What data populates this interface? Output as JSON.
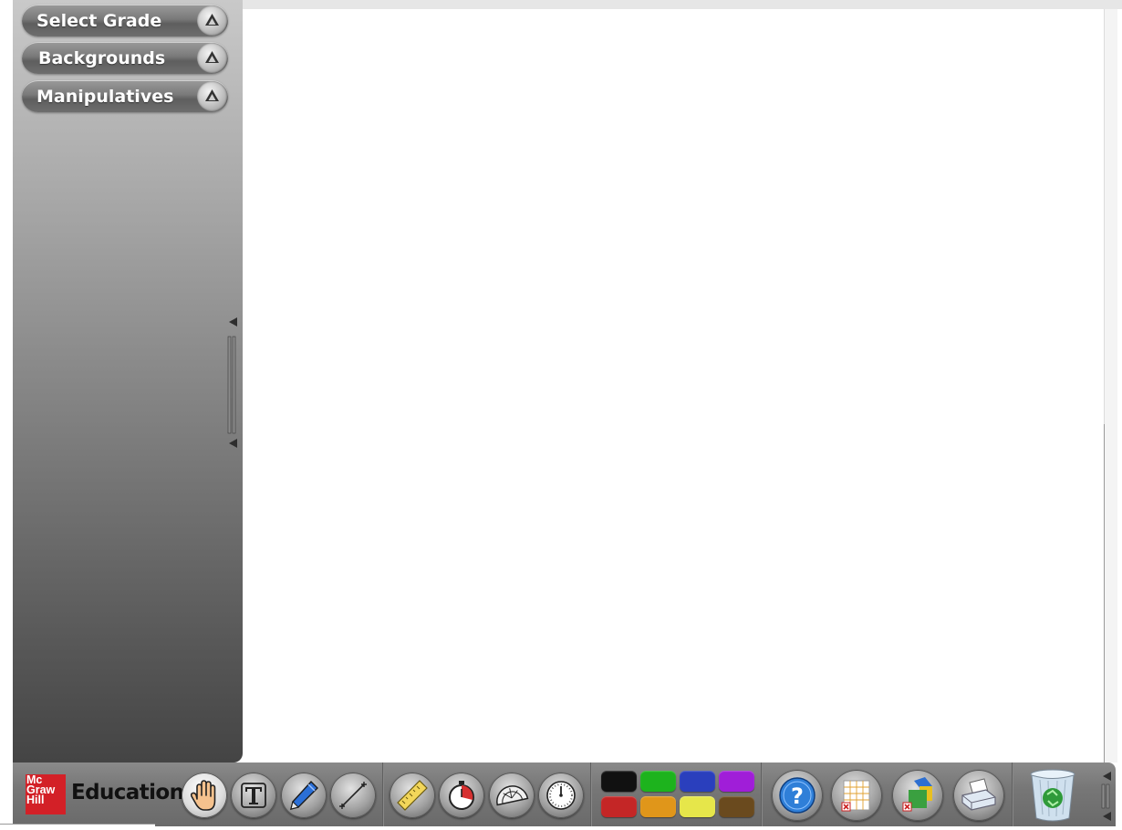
{
  "sidebar": {
    "menus": [
      {
        "label": "Select Grade",
        "icon": "chevron-up-icon"
      },
      {
        "label": "Backgrounds",
        "icon": "chevron-up-icon"
      },
      {
        "label": "Manipulatives",
        "icon": "chevron-up-icon"
      }
    ],
    "collapse_icon": "collapse-handle-icon"
  },
  "toolbar": {
    "logo": {
      "line1": "Mc",
      "line2": "Graw",
      "line3": "Hill",
      "brand": "Education"
    },
    "tools": [
      {
        "icon": "hand-pointer-icon",
        "active": true
      },
      {
        "icon": "text-tool-icon",
        "active": false
      },
      {
        "icon": "pen-icon",
        "active": false
      },
      {
        "icon": "line-tool-icon",
        "active": false
      }
    ],
    "instruments": [
      {
        "icon": "ruler-icon"
      },
      {
        "icon": "timer-icon"
      },
      {
        "icon": "protractor-icon"
      },
      {
        "icon": "clock-icon"
      }
    ],
    "colors": [
      "#111111",
      "#1db31d",
      "#2a3fbd",
      "#a01ed8",
      "#c42626",
      "#e0961a",
      "#e6e64a",
      "#6a4a1e"
    ],
    "actions": [
      {
        "icon": "help-icon"
      },
      {
        "icon": "clear-grid-icon"
      },
      {
        "icon": "clear-shapes-icon"
      },
      {
        "icon": "print-icon"
      }
    ],
    "trash_icon": "recycle-bin-icon"
  },
  "theme": {
    "logo_red": "#d32027",
    "sidebar_top": "#c9c9c9",
    "sidebar_bottom": "#444444",
    "toolbar": "#777777"
  }
}
